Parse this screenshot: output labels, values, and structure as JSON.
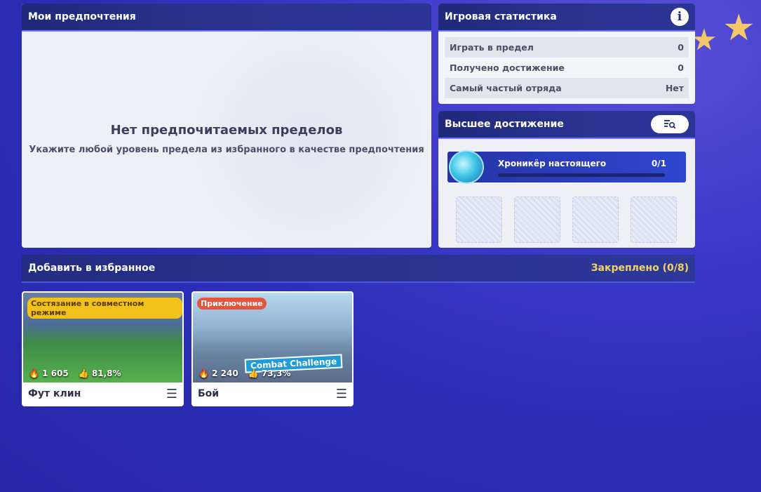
{
  "preferences": {
    "title": "Мои предпочтения",
    "empty_title": "Нет предпочитаемых пределов",
    "empty_subtitle": "Укажите любой уровень предела из избранного в качестве предпочтения"
  },
  "game_stats": {
    "title": "Игровая статистика",
    "rows": [
      {
        "label": "Играть в предел",
        "value": "0"
      },
      {
        "label": "Получено достижение",
        "value": "0"
      },
      {
        "label": "Самый частый отряда",
        "value": "Нет"
      }
    ]
  },
  "achievement": {
    "title": "Высшее достижение",
    "name": "Хроникёр настоящего",
    "count": "0/1",
    "progress": 0
  },
  "favorites": {
    "title": "Добавить в избранное",
    "pinned": "Закреплено (0/8)",
    "cards": [
      {
        "tag": "Состязание в совместном режиме",
        "plays": "1 605",
        "likes": "81,8%",
        "name": "Фут клин"
      },
      {
        "tag": "Приключение",
        "plays": "2 240",
        "likes": "73,3%",
        "name": "Бой",
        "banner": "Combat Challenge"
      }
    ]
  },
  "colors": {
    "accent_gold": "#f2d267",
    "tag_gold": "#f2c21b",
    "tag_red": "#e5533a"
  }
}
